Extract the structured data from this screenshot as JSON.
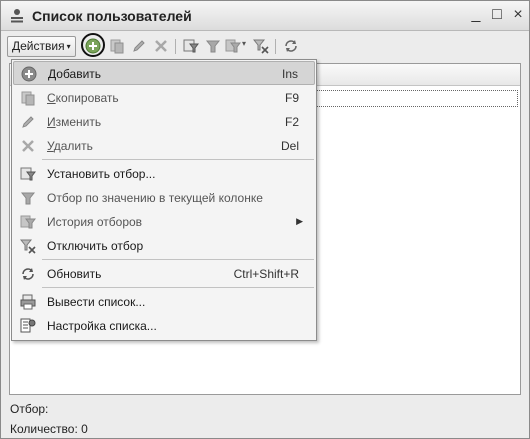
{
  "window": {
    "title": "Список пользователей",
    "minimize": "_",
    "maximize": "□",
    "close": "×"
  },
  "toolbar": {
    "actions_label": "Действия",
    "actions_arrow": "▾"
  },
  "menu": {
    "items": [
      {
        "label_first": "Д",
        "label_rest": "обавить",
        "shortcut": "Ins",
        "icon": "add-icon",
        "selected": true
      },
      {
        "label_first": "С",
        "label_rest": "копировать",
        "shortcut": "F9",
        "icon": "copy-icon"
      },
      {
        "label_first": "И",
        "label_rest": "зменить",
        "shortcut": "F2",
        "icon": "pencil-icon"
      },
      {
        "label_first": "У",
        "label_rest": "далить",
        "shortcut": "Del",
        "icon": "delete-icon"
      },
      {
        "label": "Установить отбор...",
        "icon": "filter-set-icon"
      },
      {
        "label": "Отбор по значению в текущей колонке",
        "icon": "filter-by-value-icon"
      },
      {
        "label": "История отборов",
        "submenu_arrow": "▶",
        "icon": "filter-history-icon"
      },
      {
        "label": "Отключить отбор",
        "icon": "filter-off-icon"
      },
      {
        "label": "Обновить",
        "shortcut": "Ctrl+Shift+R",
        "icon": "refresh-icon"
      },
      {
        "label": "Вывести список...",
        "icon": "print-list-icon"
      },
      {
        "label": "Настройка списка...",
        "icon": "list-settings-icon"
      }
    ]
  },
  "footer": {
    "filter_label": "Отбор:",
    "count_label": "Количество: 0"
  },
  "colors": {
    "accent_green": "#6a9a4a",
    "selection": "#d5d5d5"
  }
}
